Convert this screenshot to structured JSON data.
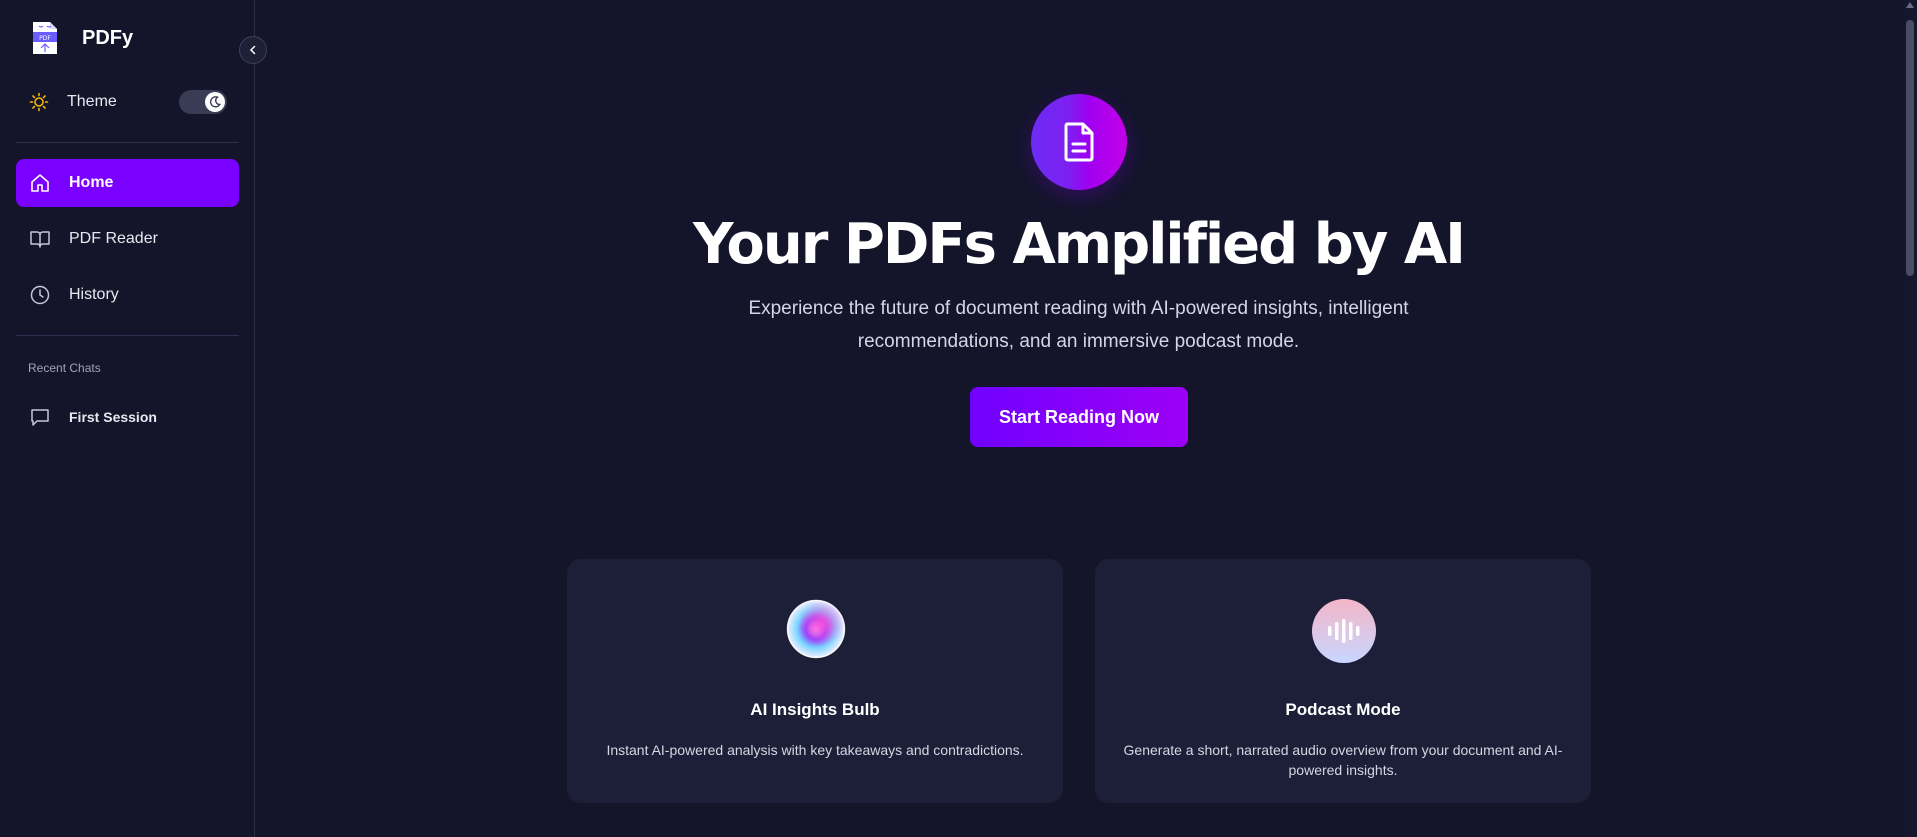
{
  "app": {
    "name": "PDFy"
  },
  "sidebar": {
    "theme_label": "Theme",
    "nav": [
      {
        "label": "Home",
        "icon": "home-icon",
        "active": true
      },
      {
        "label": "PDF Reader",
        "icon": "book-icon",
        "active": false
      },
      {
        "label": "History",
        "icon": "clock-icon",
        "active": false
      }
    ],
    "recent_title": "Recent Chats",
    "chats": [
      {
        "label": "First Session",
        "icon": "chat-icon"
      }
    ]
  },
  "hero": {
    "icon": "document-icon",
    "title": "Your PDFs Amplified by AI",
    "subtitle": "Experience the future of document reading with AI-powered insights, intelligent recommendations, and an immersive podcast mode.",
    "cta_label": "Start Reading Now"
  },
  "features": [
    {
      "title": "AI Insights Bulb",
      "desc": "Instant AI-powered analysis with key takeaways and contradictions.",
      "icon": "insights-orb-icon"
    },
    {
      "title": "Podcast Mode",
      "desc": "Generate a short, narrated audio overview from your document and AI-powered insights.",
      "icon": "audio-wave-icon"
    }
  ],
  "colors": {
    "accent": "#7a00ff",
    "background": "#14142b",
    "card": "#1d1f38",
    "theme_sun": "#f5b800"
  }
}
